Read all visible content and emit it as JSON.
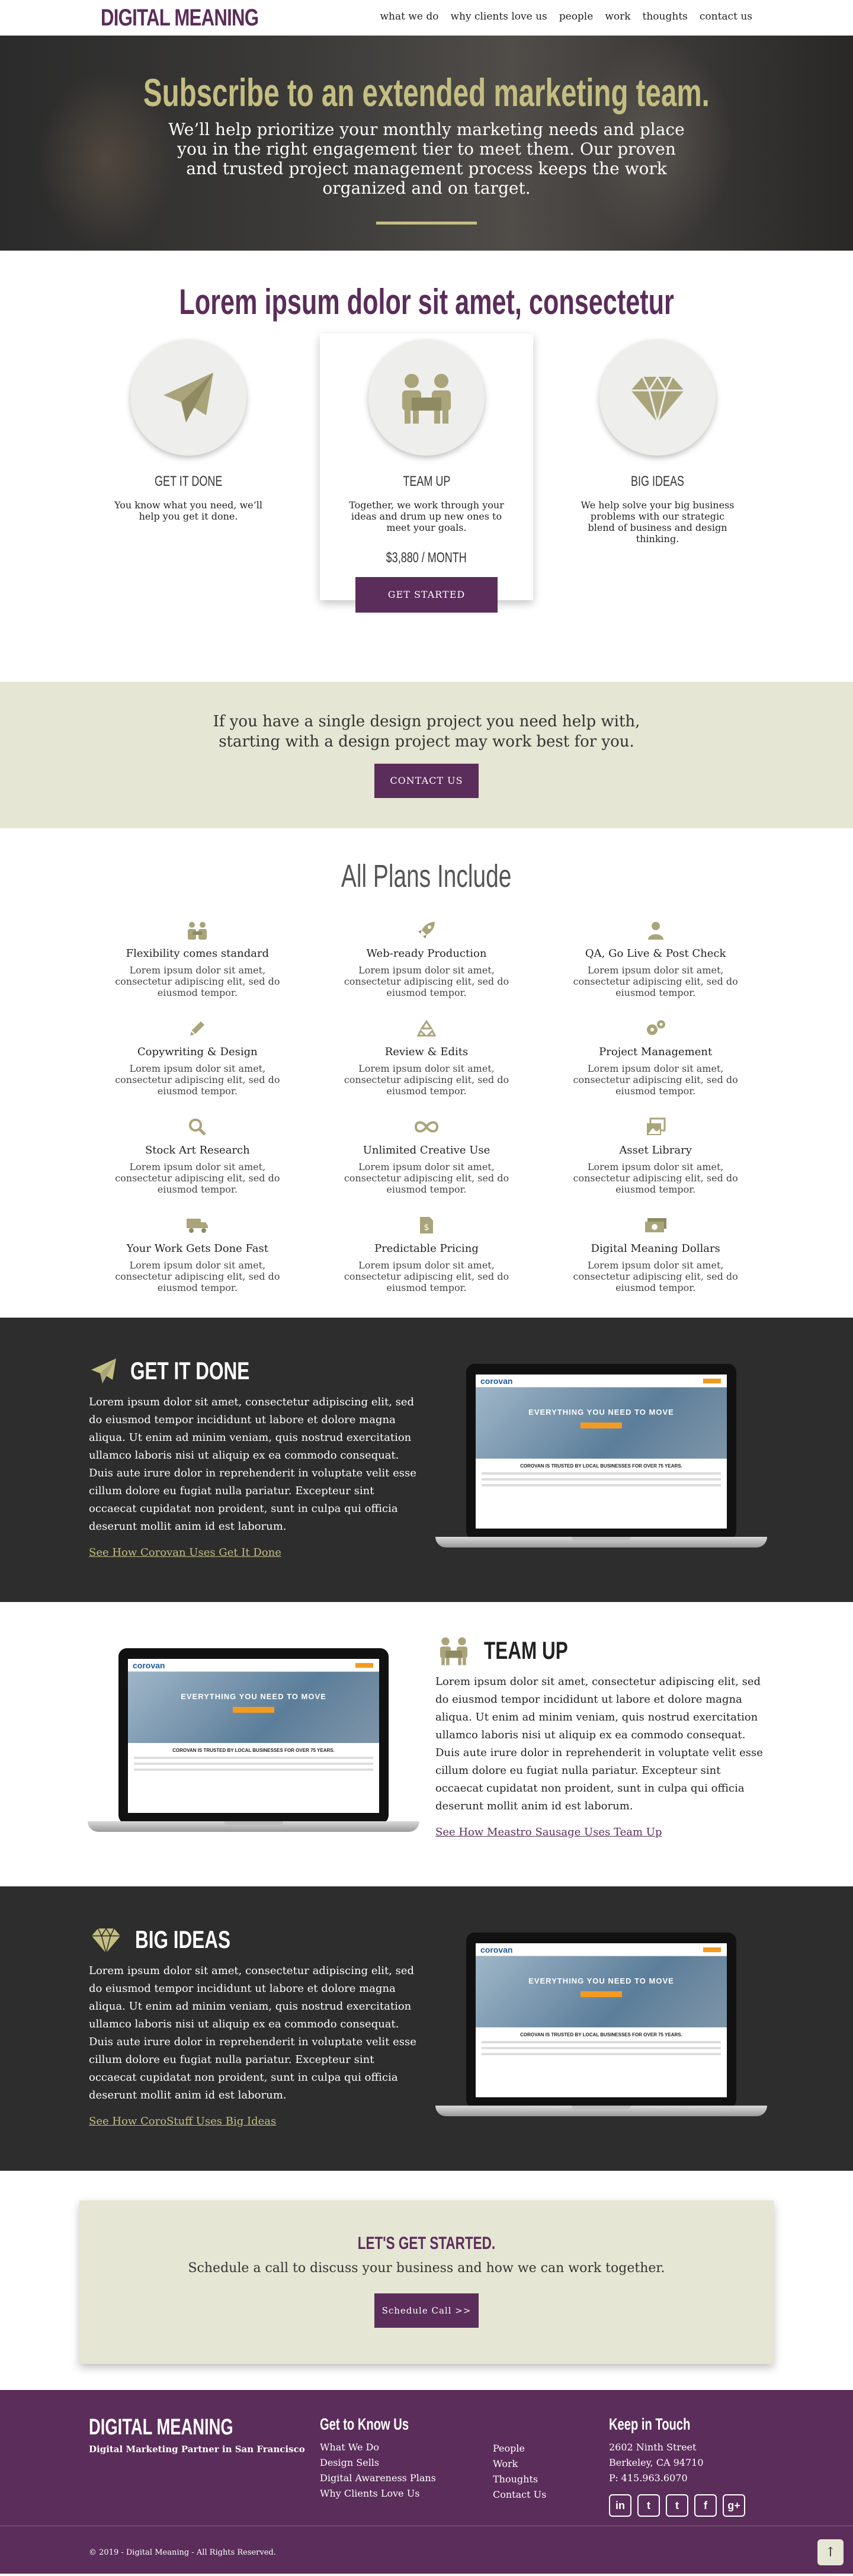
{
  "nav": {
    "logo": "DIGITAL MEANING",
    "items": [
      "what we do",
      "why clients love us",
      "people",
      "work",
      "thoughts",
      "contact us"
    ]
  },
  "hero": {
    "title": "Subscribe to an extended marketing team.",
    "text": "We’ll help prioritize your monthly marketing needs and place you in the right engagement tier to meet them. Our proven and trusted project management process keeps the work organized and on target."
  },
  "features": {
    "heading": "Lorem ipsum dolor sit amet, consectetur",
    "cols": [
      {
        "title": "GET IT DONE",
        "text": "You know what you need, we’ll help you get it done.",
        "icon": "paper-plane-icon"
      },
      {
        "title": "TEAM UP",
        "text": "Together, we work through your ideas and drum up new ones to meet your goals.",
        "icon": "team-icon",
        "price": "$3,880 / MONTH",
        "button": "GET STARTED"
      },
      {
        "title": "BIG IDEAS",
        "text": "We help solve your big business problems with our strategic blend of business and design thinking.",
        "icon": "diamond-icon"
      }
    ]
  },
  "band": {
    "text": "If you have a single design project you need help with, starting with a design project may work best for you.",
    "button": "CONTACT US"
  },
  "plans": {
    "heading": "All Plans Include",
    "items": [
      {
        "title": "Flexibility comes standard",
        "text": "Lorem ipsum dolor sit amet, consectetur adipiscing elit, sed do eiusmod tempor.",
        "icon": "people-icon"
      },
      {
        "title": "Web-ready Production",
        "text": "Lorem ipsum dolor sit amet, consectetur adipiscing elit, sed do eiusmod tempor.",
        "icon": "rocket-icon"
      },
      {
        "title": "QA, Go Live & Post Check",
        "text": "Lorem ipsum dolor sit amet, consectetur adipiscing elit, sed do eiusmod tempor.",
        "icon": "user-icon"
      },
      {
        "title": "Copywriting & Design",
        "text": "Lorem ipsum dolor sit amet, consectetur adipiscing elit, sed do eiusmod tempor.",
        "icon": "pencil-icon"
      },
      {
        "title": "Review & Edits",
        "text": "Lorem ipsum dolor sit amet, consectetur adipiscing elit, sed do eiusmod tempor.",
        "icon": "recycle-icon"
      },
      {
        "title": "Project Management",
        "text": "Lorem ipsum dolor sit amet, consectetur adipiscing elit, sed do eiusmod tempor.",
        "icon": "gears-icon"
      },
      {
        "title": "Stock Art Research",
        "text": "Lorem ipsum dolor sit amet, consectetur adipiscing elit, sed do eiusmod tempor.",
        "icon": "magnifier-icon"
      },
      {
        "title": "Unlimited Creative Use",
        "text": "Lorem ipsum dolor sit amet, consectetur adipiscing elit, sed do eiusmod tempor.",
        "icon": "infinity-icon"
      },
      {
        "title": "Asset Library",
        "text": "Lorem ipsum dolor sit amet, consectetur adipiscing elit, sed do eiusmod tempor.",
        "icon": "images-icon"
      },
      {
        "title": "Your Work Gets Done Fast",
        "text": "Lorem ipsum dolor sit amet, consectetur adipiscing elit, sed do eiusmod tempor.",
        "icon": "truck-icon"
      },
      {
        "title": "Predictable Pricing",
        "text": "Lorem ipsum dolor sit amet, consectetur adipiscing elit, sed do eiusmod tempor.",
        "icon": "invoice-icon"
      },
      {
        "title": "Digital Meaning Dollars",
        "text": "Lorem ipsum dolor sit amet, consectetur adipiscing elit, sed do eiusmod tempor.",
        "icon": "money-icon"
      }
    ]
  },
  "showcases": [
    {
      "title": "GET IT DONE",
      "text": "Lorem ipsum dolor sit amet, consectetur adipiscing elit, sed do eiusmod tempor incididunt ut labore et dolore magna aliqua. Ut enim ad minim veniam, quis nostrud exercitation ullamco laboris nisi ut aliquip ex ea commodo consequat. Duis aute irure dolor in reprehenderit in voluptate velit esse cillum dolore eu fugiat nulla pariatur. Excepteur sint occaecat cupidatat non proident, sunt in culpa qui officia deserunt mollit anim id est laborum.",
      "link": "See How Corovan Uses Get It Done",
      "icon": "paper-plane-icon"
    },
    {
      "title": "TEAM UP",
      "text": "Lorem ipsum dolor sit amet, consectetur adipiscing elit, sed do eiusmod tempor incididunt ut labore et dolore magna aliqua. Ut enim ad minim veniam, quis nostrud exercitation ullamco laboris nisi ut aliquip ex ea commodo consequat. Duis aute irure dolor in reprehenderit in voluptate velit esse cillum dolore eu fugiat nulla pariatur. Excepteur sint occaecat cupidatat non proident, sunt in culpa qui officia deserunt mollit anim id est laborum.",
      "link": "See How Meastro Sausage Uses Team Up",
      "icon": "team-icon"
    },
    {
      "title": "BIG IDEAS",
      "text": "Lorem ipsum dolor sit amet, consectetur adipiscing elit, sed do eiusmod tempor incididunt ut labore et dolore magna aliqua. Ut enim ad minim veniam, quis nostrud exercitation ullamco laboris nisi ut aliquip ex ea commodo consequat. Duis aute irure dolor in reprehenderit in voluptate velit esse cillum dolore eu fugiat nulla pariatur. Excepteur sint occaecat cupidatat non proident, sunt in culpa qui officia deserunt mollit anim id est laborum.",
      "link": "See How CoroStuff Uses Big Ideas",
      "icon": "diamond-icon"
    }
  ],
  "laptop": {
    "brand": "corovan",
    "hero_text": "EVERYTHING YOU NEED TO MOVE",
    "tagline": "COROVAN IS TRUSTED BY LOCAL BUSINESSES FOR OVER 75 YEARS."
  },
  "cta": {
    "title": "LET'S GET STARTED.",
    "text": "Schedule a call to discuss your business and how we can work together.",
    "button": "Schedule Call >>"
  },
  "footer": {
    "logo": "DIGITAL MEANING",
    "tagline": "Digital Marketing Partner in San Francisco",
    "know_title": "Get to Know Us",
    "know_col1": [
      "What We Do",
      "Design Sells",
      "Digital Awareness Plans",
      "Why Clients Love Us"
    ],
    "know_col2": [
      "People",
      "Work",
      "Thoughts",
      "Contact Us"
    ],
    "touch_title": "Keep in Touch",
    "address1": "2602 Ninth Street",
    "address2": "Berkeley, CA 94710",
    "phone": "P: 415.963.6070",
    "socials": [
      "in",
      "t",
      "t",
      "f",
      "g+"
    ],
    "copyright": "© 2019 - Digital Meaning - All Rights Reserved."
  },
  "colors": {
    "brand": "#5b2d5a",
    "accent": "#c4be82",
    "band": "#e6e6d4",
    "dark": "#2d2d2d"
  }
}
